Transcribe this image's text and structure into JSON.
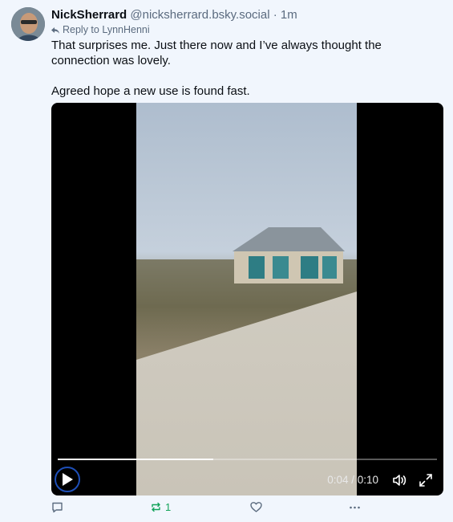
{
  "post": {
    "display_name": "NickSherrard",
    "handle": "@nicksherrard.bsky.social",
    "separator": " · ",
    "time": "1m",
    "reply_to": "Reply to LynnHenni",
    "text_line1": "That surprises me. Just there now and I’ve always thought the connection was lovely.",
    "text_line2": "Agreed hope a new use is found fast."
  },
  "video": {
    "time": "0:04 / 0:10",
    "progress": 0.41
  },
  "actions": {
    "reply_count": "",
    "repost_count": "1",
    "like_count": ""
  },
  "colors": {
    "background": "#f1f6fd",
    "muted": "#5b6b7f",
    "repost_green": "#13a35a",
    "play_ring": "#1e4fb8"
  }
}
